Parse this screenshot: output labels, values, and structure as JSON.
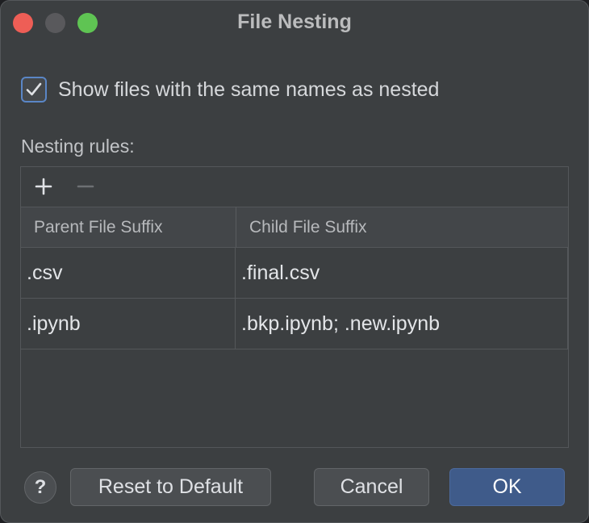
{
  "window": {
    "title": "File Nesting"
  },
  "options": {
    "show_nested_label": "Show files with the same names as nested",
    "show_nested_checked": true
  },
  "rules": {
    "section_label": "Nesting rules:",
    "columns": [
      "Parent File Suffix",
      "Child File Suffix"
    ],
    "rows": [
      {
        "parent": ".csv",
        "child": ".final.csv"
      },
      {
        "parent": ".ipynb",
        "child": ".bkp.ipynb; .new.ipynb"
      }
    ]
  },
  "buttons": {
    "help": "?",
    "reset": "Reset to Default",
    "cancel": "Cancel",
    "ok": "OK"
  },
  "icons": {
    "add": "plus-icon",
    "remove": "minus-icon",
    "check": "checkmark-icon"
  },
  "colors": {
    "accent": "#5a86c6",
    "ok_button": "#3f5b8a",
    "close": "#ee5e56",
    "maximize": "#5fc453"
  }
}
